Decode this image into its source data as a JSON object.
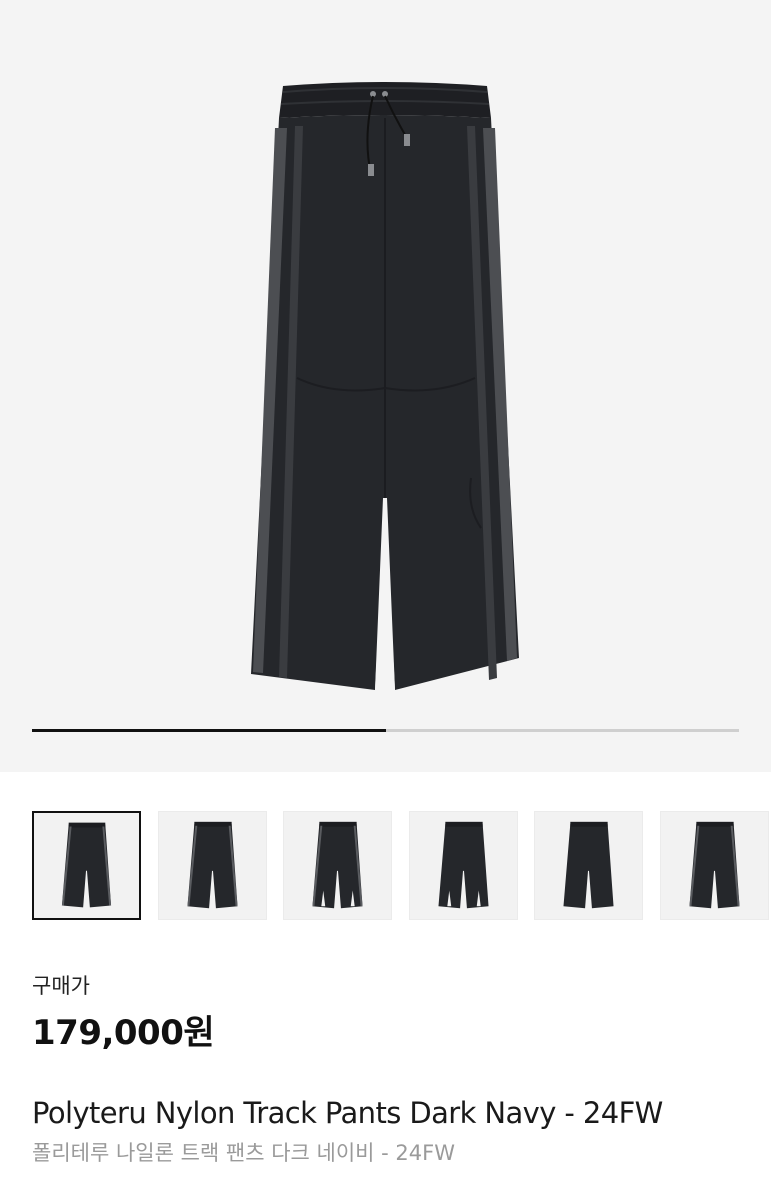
{
  "gallery": {
    "main_image": "wide-leg-track-pants-dark-navy-front",
    "progress": 0.5,
    "thumbnails": [
      {
        "view": "front",
        "selected": true
      },
      {
        "view": "front-stripes",
        "selected": false
      },
      {
        "view": "front-slit",
        "selected": false
      },
      {
        "view": "back",
        "selected": false
      },
      {
        "view": "side",
        "selected": false
      },
      {
        "view": "folded-angle",
        "selected": false
      }
    ]
  },
  "product": {
    "price_label": "구매가",
    "price": "179,000원",
    "title_en": "Polyteru Nylon Track Pants Dark Navy - 24FW",
    "title_ko": "폴리테루 나일론 트랙 팬츠 다크 네이비 - 24FW"
  },
  "colors": {
    "pants": "#25272b",
    "pants_shade": "#1c1d21",
    "stripe": "#5a5c60",
    "hero_bg": "#f4f4f4",
    "progress_fill": "#111111",
    "progress_track": "#cfcfcf"
  }
}
